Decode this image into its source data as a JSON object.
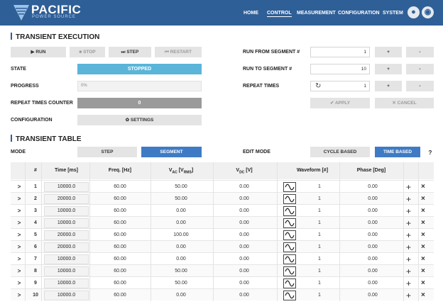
{
  "header": {
    "logo_name": "PACIFIC",
    "logo_sub": "POWER SOURCE",
    "nav": [
      "HOME",
      "CONTROL",
      "MEASUREMENT",
      "CONFIGURATION",
      "SYSTEM"
    ],
    "active_nav": "CONTROL",
    "colors": {
      "bar": "#2f5f97",
      "accent": "#3f7bc4",
      "state": "#5ab5d9"
    }
  },
  "execution": {
    "title": "TRANSIENT EXECUTION",
    "buttons": {
      "run": "RUN",
      "stop": "STOP",
      "step": "STEP",
      "restart": "RESTART",
      "settings": "SETTINGS",
      "apply": "APPLY",
      "cancel": "CANCEL"
    },
    "labels": {
      "state": "STATE",
      "progress": "PROGRESS",
      "repeat_counter": "REPEAT TIMES COUNTER",
      "configuration": "CONFIGURATION",
      "run_from": "RUN FROM SEGMENT #",
      "run_to": "RUN TO SEGMENT #",
      "repeat_times": "REPEAT TIMES"
    },
    "state_value": "STOPPED",
    "progress_text": "0%",
    "progress_fraction": 0.0,
    "counter_value": "0",
    "run_from_value": "1",
    "run_to_value": "10",
    "repeat_times_value": "1",
    "plus": "+",
    "minus": "-"
  },
  "table": {
    "title": "TRANSIENT TABLE",
    "mode_label": "MODE",
    "mode_options": [
      "STEP",
      "SEGMENT"
    ],
    "mode_selected": "SEGMENT",
    "edit_mode_label": "EDIT MODE",
    "edit_options": [
      "CYCLE BASED",
      "TIME BASED"
    ],
    "edit_selected": "TIME BASED",
    "help": "?",
    "columns": {
      "index": "#",
      "time": "Time [ms]",
      "freq": "Freq. [Hz]",
      "vac_main": "V",
      "vac_sub": "AC",
      "vac_unit": "[V",
      "vac_unit_sub": "RMS",
      "vac_close": "]",
      "vdc_main": "V",
      "vdc_sub": "DC",
      "vdc_unit": "[V]",
      "waveform": "Waveform [#]",
      "phase": "Phase [Deg]"
    },
    "expand_glyph": ">",
    "add_glyph": "+",
    "delete_glyph": "×",
    "rows": [
      {
        "n": "1",
        "time": "10000.0",
        "freq": "60.00",
        "vac": "50.00",
        "vdc": "0.00",
        "wave": "1",
        "phase": "0.00"
      },
      {
        "n": "2",
        "time": "20000.0",
        "freq": "60.00",
        "vac": "50.00",
        "vdc": "0.00",
        "wave": "1",
        "phase": "0.00"
      },
      {
        "n": "3",
        "time": "10000.0",
        "freq": "60.00",
        "vac": "0.00",
        "vdc": "0.00",
        "wave": "1",
        "phase": "0.00"
      },
      {
        "n": "4",
        "time": "10000.0",
        "freq": "60.00",
        "vac": "0.00",
        "vdc": "0.00",
        "wave": "1",
        "phase": "0.00"
      },
      {
        "n": "5",
        "time": "20000.0",
        "freq": "60.00",
        "vac": "100.00",
        "vdc": "0.00",
        "wave": "1",
        "phase": "0.00"
      },
      {
        "n": "6",
        "time": "20000.0",
        "freq": "60.00",
        "vac": "0.00",
        "vdc": "0.00",
        "wave": "1",
        "phase": "0.00"
      },
      {
        "n": "7",
        "time": "10000.0",
        "freq": "60.00",
        "vac": "0.00",
        "vdc": "0.00",
        "wave": "1",
        "phase": "0.00"
      },
      {
        "n": "8",
        "time": "10000.0",
        "freq": "60.00",
        "vac": "50.00",
        "vdc": "0.00",
        "wave": "1",
        "phase": "0.00"
      },
      {
        "n": "9",
        "time": "10000.0",
        "freq": "60.00",
        "vac": "50.00",
        "vdc": "0.00",
        "wave": "1",
        "phase": "0.00"
      },
      {
        "n": "10",
        "time": "10000.0",
        "freq": "60.00",
        "vac": "0.00",
        "vdc": "0.00",
        "wave": "1",
        "phase": "0.00"
      }
    ]
  }
}
